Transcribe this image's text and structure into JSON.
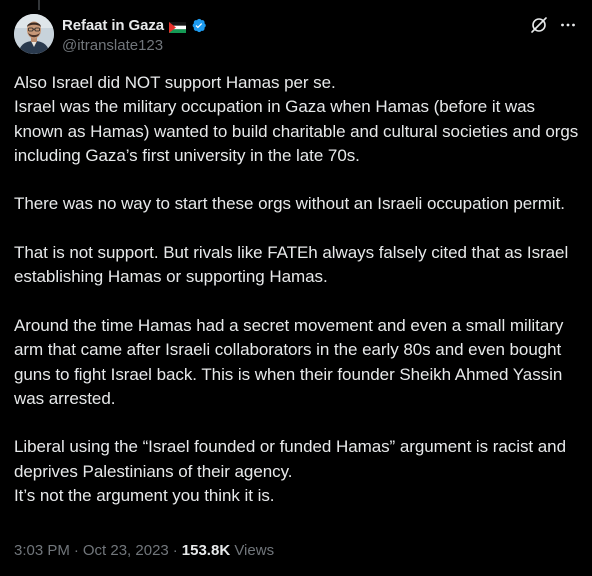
{
  "author": {
    "display_name": "Refaat in Gaza",
    "handle": "@itranslate123"
  },
  "tweet": {
    "text": "Also Israel did NOT support Hamas per se.\nIsrael was the military occupation in Gaza when Hamas (before it was known as Hamas) wanted to build charitable and cultural societies and orgs including Gaza’s first university in the late 70s.\n\nThere was no way to start these orgs without an Israeli occupation permit.\n\nThat is not support. But rivals like FATEh always falsely cited that as Israel establishing Hamas or supporting Hamas.\n\nAround the time Hamas had a secret movement and even a small military arm that came after Israeli collaborators in the early 80s and even bought guns to fight Israel back. This is when their founder Sheikh Ahmed Yassin was arrested.\n\nLiberal using the “Israel founded or funded Hamas” argument is racist and deprives Palestinians of their agency.\nIt’s not the argument you think it is."
  },
  "meta": {
    "time": "3:03 PM",
    "separator": "·",
    "date": "Oct 23, 2023",
    "views_count": "153.8K",
    "views_label": "Views"
  },
  "colors": {
    "background": "#000000",
    "text_primary": "#e7e9ea",
    "text_secondary": "#71767b",
    "verified_badge": "#1d9bf0"
  },
  "icons": {
    "flag": "palestine-flag-icon",
    "verified": "verified-badge-icon",
    "grok": "grok-icon",
    "more": "more-options-icon"
  }
}
